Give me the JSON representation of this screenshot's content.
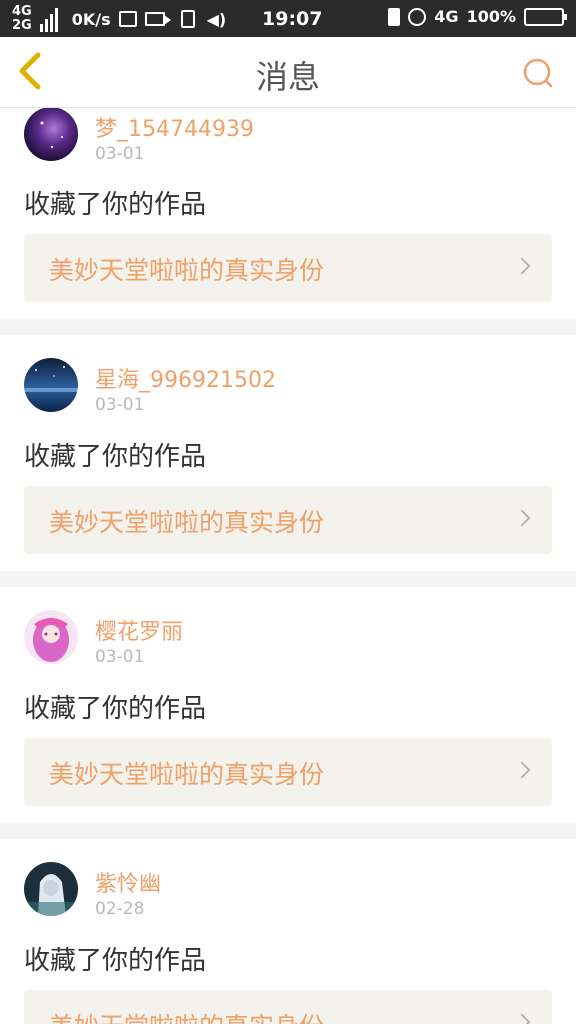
{
  "status_bar": {
    "network_top": "4G",
    "network_bottom": "2G",
    "speed": "0K/s",
    "vibrate": "◀)",
    "time": "19:07",
    "network_right": "4G",
    "battery": "100%"
  },
  "header": {
    "title": "消息",
    "back_icon": "chevron-left-icon",
    "search_icon": "search-icon"
  },
  "colors": {
    "accent": "#f0a068",
    "back_arrow": "#e0b000"
  },
  "messages": [
    {
      "username": "梦_154744939",
      "date": "03-01",
      "action": "收藏了你的作品",
      "work_title": "美妙天堂啦啦的真实身份"
    },
    {
      "username": "星海_996921502",
      "date": "03-01",
      "action": "收藏了你的作品",
      "work_title": "美妙天堂啦啦的真实身份"
    },
    {
      "username": "樱花罗丽",
      "date": "03-01",
      "action": "收藏了你的作品",
      "work_title": "美妙天堂啦啦的真实身份"
    },
    {
      "username": "紫怜幽",
      "date": "02-28",
      "action": "收藏了你的作品",
      "work_title": "美妙天堂啦啦的真实身份"
    }
  ]
}
